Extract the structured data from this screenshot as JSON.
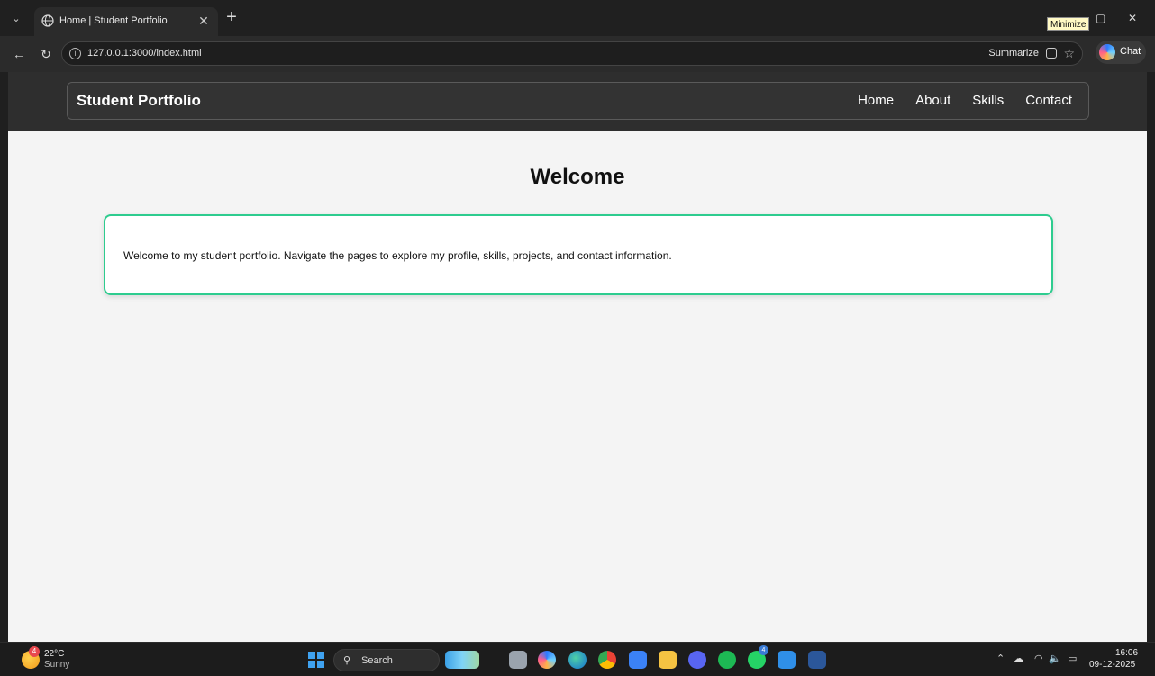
{
  "browser": {
    "tab_title": "Home | Student Portfolio",
    "tab_close": "✕",
    "new_tab": "+",
    "tooltip": "Minimize",
    "url": "127.0.0.1:3000/index.html",
    "summarize_label": "Summarize",
    "chat_label": "Chat"
  },
  "site": {
    "brand": "Student Portfolio",
    "nav": [
      "Home",
      "About",
      "Skills",
      "Contact"
    ],
    "heading": "Welcome",
    "intro": "Welcome to my student portfolio. Navigate the pages to explore my profile, skills, projects, and contact information."
  },
  "taskbar": {
    "weather_badge": "4",
    "temperature": "22°C",
    "condition": "Sunny",
    "search_label": "Search",
    "whatsapp_badge": "4",
    "time": "16:06",
    "date": "09-12-2025"
  },
  "colors": {
    "card_border": "#2ecc8f",
    "header_bg": "#2e2e2e",
    "page_bg": "#f4f4f4"
  }
}
